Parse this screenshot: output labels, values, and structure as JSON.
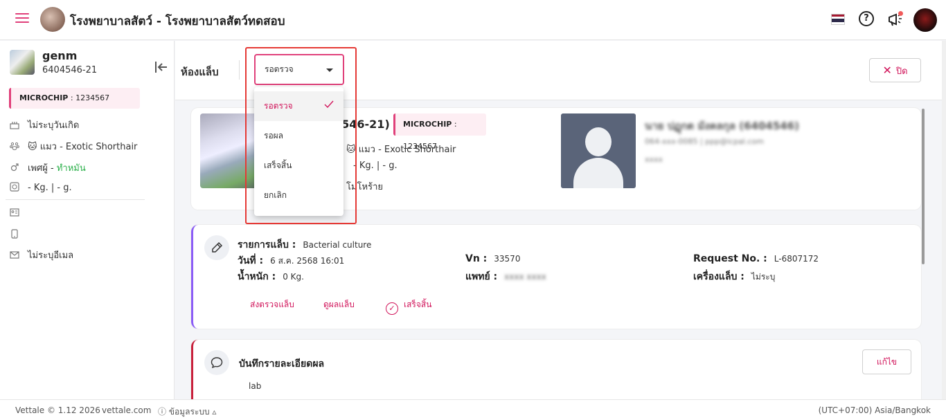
{
  "header": {
    "title": "โรงพยาบาลสัตว์ - โรงพยาบาลสัตว์ทดสอบ",
    "help_symbol": "?"
  },
  "sidebar": {
    "pet_name": "genm",
    "pet_hn": "6404546-21",
    "microchip_label": "MICROCHIP",
    "microchip_value": " : 1234567",
    "birthdate": "ไม่ระบุวันเกิด",
    "species_emoji": "🐱",
    "species": "แมว - Exotic Shorthair",
    "sex_label": "เพศผู้ - ",
    "sterile_status": "ทำหมัน",
    "weight": "- Kg. | - g.",
    "email": "ไม่ระบุอีเมล"
  },
  "toolbar": {
    "section_title": "ห้องแล็บ",
    "status_selected": "รอตรวจ",
    "close_label": "ปิด"
  },
  "status_options": [
    "รอตรวจ",
    "รอผล",
    "เสร็จสิ้น",
    "ยกเลิก"
  ],
  "pet_card": {
    "hn_partial": "4546-21)",
    "microchip_label": "MICROCHIP",
    "microchip_value": " : 1234567",
    "species_emoji": "🐱",
    "species": " แมว - Exotic Shorthair",
    "weight_partial": "- Kg. | - g.",
    "temperament_partial": "โมโหร้าย",
    "owner_name": "นาย ปฏุกต มังคลกุล (6404546)",
    "owner_contact": "064-xxx-0085  |  ppp@icpal.com",
    "owner_extra": "xxxx"
  },
  "lab_card": {
    "item_label": "รายการแล็บ :",
    "item_value": "Bacterial culture",
    "date_label": "วันที่ :",
    "date_value": "6 ส.ค. 2568 16:01",
    "weight_label": "น้ำหนัก :",
    "weight_value": "0 Kg.",
    "vn_label": "Vn :",
    "vn_value": "33570",
    "doctor_label": "แพทย์ :",
    "doctor_value": "xxxx xxxx",
    "request_label": "Request No. :",
    "request_value": "L-6807172",
    "machine_label": "เครื่องแล็บ :",
    "machine_value": "ไม่ระบุ",
    "action_send": "ส่งตรวจแล็บ",
    "action_view": "ดูผลแล็บ",
    "action_done": "เสร็จสิ้น"
  },
  "note_card": {
    "title": "บันทึกรายละเอียดผล",
    "text": "lab",
    "edit_label": "แก้ไข"
  },
  "footer": {
    "copyright": "Vettale © 1.12 2026",
    "site": "vettale.com",
    "system_info": "ⓘ ข้อมูลระบบ ▵",
    "timezone": "(UTC+07:00) Asia/Bangkok"
  },
  "colors": {
    "accent": "#d1145a",
    "lab_card_border": "#8b5cf6",
    "note_card_border": "#c8203c",
    "highlight_frame": "#e53935"
  }
}
